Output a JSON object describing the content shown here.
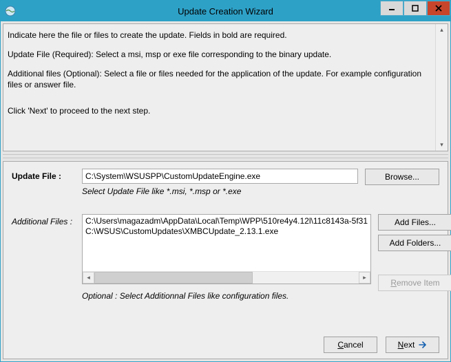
{
  "window": {
    "title": "Update Creation Wizard"
  },
  "instructions": {
    "line1": "Indicate here the file or files to create the update. Fields in bold are required.",
    "line2": "Update File (Required): Select a msi, msp or exe file corresponding to the binary update.",
    "line3": "Additional files (Optional): Select a file or files needed for the application of the update. For example configuration files or answer file.",
    "line4": "Click 'Next' to proceed to the next step."
  },
  "updateFile": {
    "label": "Update File :",
    "value": "C:\\System\\WSUSPP\\CustomUpdateEngine.exe",
    "hint": "Select Update File like *.msi, *.msp or *.exe",
    "browse": "Browse..."
  },
  "additionalFiles": {
    "label": "Additional Files :",
    "items": [
      "C:\\Users\\magazadm\\AppData\\Local\\Temp\\WPP\\510re4y4.12l\\11c8143a-5f31",
      "C:\\WSUS\\CustomUpdates\\XMBCUpdate_2.13.1.exe"
    ],
    "hint": "Optional : Select Additionnal Files like configuration files.",
    "addFiles": "Add Files...",
    "addFolders": "Add Folders...",
    "removeItemPrefix": "R",
    "removeItemRest": "emove Item"
  },
  "buttons": {
    "cancelPrefix": "C",
    "cancelRest": "ancel",
    "nextPrefix": "N",
    "nextRest": "ext"
  }
}
